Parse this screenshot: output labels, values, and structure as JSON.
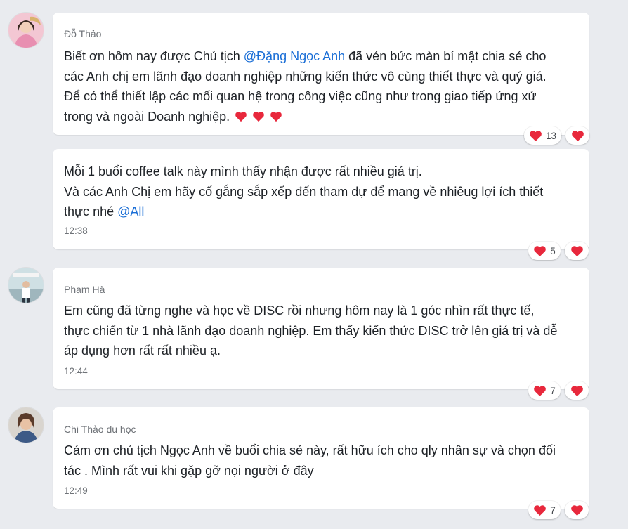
{
  "messages": [
    {
      "sender": "Đỗ Thảo",
      "lines": [
        {
          "parts": [
            {
              "t": "Biết ơn hôm nay được Chủ tịch "
            },
            {
              "t": "@Đặng Ngọc Anh",
              "mention": true
            },
            {
              "t": "  đã vén bức màn bí mật chia sẻ cho"
            }
          ]
        },
        {
          "parts": [
            {
              "t": "các Anh chị em lãnh đạo doanh nghiệp những kiến thức vô cùng thiết thực và quý giá."
            }
          ]
        },
        {
          "parts": [
            {
              "t": "Để có thể thiết lập các mối quan hệ  trong công việc cũng như trong giao tiếp ứng xử"
            }
          ]
        },
        {
          "parts": [
            {
              "t": "trong và ngoài Doanh nghiệp. "
            }
          ],
          "hearts": 3
        }
      ],
      "time": "",
      "reaction_count": "13"
    },
    {
      "sender": "",
      "lines": [
        {
          "parts": [
            {
              "t": "Mỗi 1 buổi coffee talk này mình thấy nhận được rất nhiều giá trị."
            }
          ]
        },
        {
          "parts": [
            {
              "t": "Và các Anh Chị em hãy cố gắng sắp xếp đến tham dự để mang về nhiêug lợi ích thiết"
            }
          ]
        },
        {
          "parts": [
            {
              "t": "thực nhé "
            },
            {
              "t": "@All",
              "mention": true
            }
          ]
        }
      ],
      "time": "12:38",
      "reaction_count": "5"
    },
    {
      "sender": "Phạm Hà",
      "lines": [
        {
          "parts": [
            {
              "t": "Em cũng đã từng nghe và học về DISC rồi nhưng hôm nay là 1 góc nhìn rất thực tế,"
            }
          ]
        },
        {
          "parts": [
            {
              "t": "thực chiến từ 1 nhà lãnh đạo doanh nghiệp. Em thấy kiến thức DISC trở lên giá trị và dễ"
            }
          ]
        },
        {
          "parts": [
            {
              "t": "áp dụng hơn rất rất nhiều ạ."
            }
          ]
        }
      ],
      "time": "12:44",
      "reaction_count": "7"
    },
    {
      "sender": "Chi Thảo du học",
      "lines": [
        {
          "parts": [
            {
              "t": "Cám ơn chủ tịch Ngọc Anh về buổi chia sẻ này, rất hữu ích cho qly nhân sự và chọn đối"
            }
          ]
        },
        {
          "parts": [
            {
              "t": "tác . Mình rất vui khi gặp gỡ nọi người ở đây"
            }
          ]
        }
      ],
      "time": "12:49",
      "reaction_count": "7"
    }
  ],
  "colors": {
    "mention": "#1a6ed6",
    "heart": "#e8283c",
    "background": "#e9ebef"
  },
  "icons": {
    "heart": "heart-icon",
    "react": "heart-react-icon"
  }
}
